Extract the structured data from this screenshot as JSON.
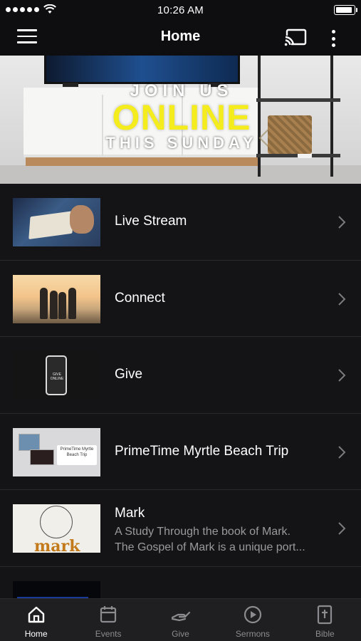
{
  "status_bar": {
    "time": "10:26 AM"
  },
  "header": {
    "title": "Home"
  },
  "banner": {
    "line1": "JOIN US",
    "line2": "ONLINE",
    "line3": "THIS SUNDAY"
  },
  "list": {
    "items": [
      {
        "title": "Live Stream",
        "thumb_icon": "bible-reading-thumbnail"
      },
      {
        "title": "Connect",
        "thumb_icon": "friends-sunset-thumbnail"
      },
      {
        "title": "Give",
        "thumb_icon": "give-online-phone-thumbnail",
        "thumb_text": "GIVE ONLINE"
      },
      {
        "title": "PrimeTime Myrtle Beach Trip",
        "thumb_icon": "trip-collage-thumbnail",
        "thumb_sign": "PrimeTime Myrtle Beach Trip"
      },
      {
        "title": "Mark",
        "subtitle_line1": "A Study Through the book of Mark.",
        "subtitle_line2": "The Gospel of Mark is a unique port...",
        "thumb_icon": "mark-series-thumbnail",
        "thumb_word": "mark"
      }
    ]
  },
  "tabs": [
    {
      "label": "Home",
      "icon": "home-icon",
      "active": true
    },
    {
      "label": "Events",
      "icon": "calendar-icon",
      "active": false
    },
    {
      "label": "Give",
      "icon": "giving-hand-icon",
      "active": false
    },
    {
      "label": "Sermons",
      "icon": "play-circle-icon",
      "active": false
    },
    {
      "label": "Bible",
      "icon": "bible-icon",
      "active": false
    }
  ],
  "colors": {
    "background": "#141416",
    "bar": "#0e0e10",
    "accent_yellow": "#f5ec1e",
    "tab_inactive": "#8b8b90"
  }
}
